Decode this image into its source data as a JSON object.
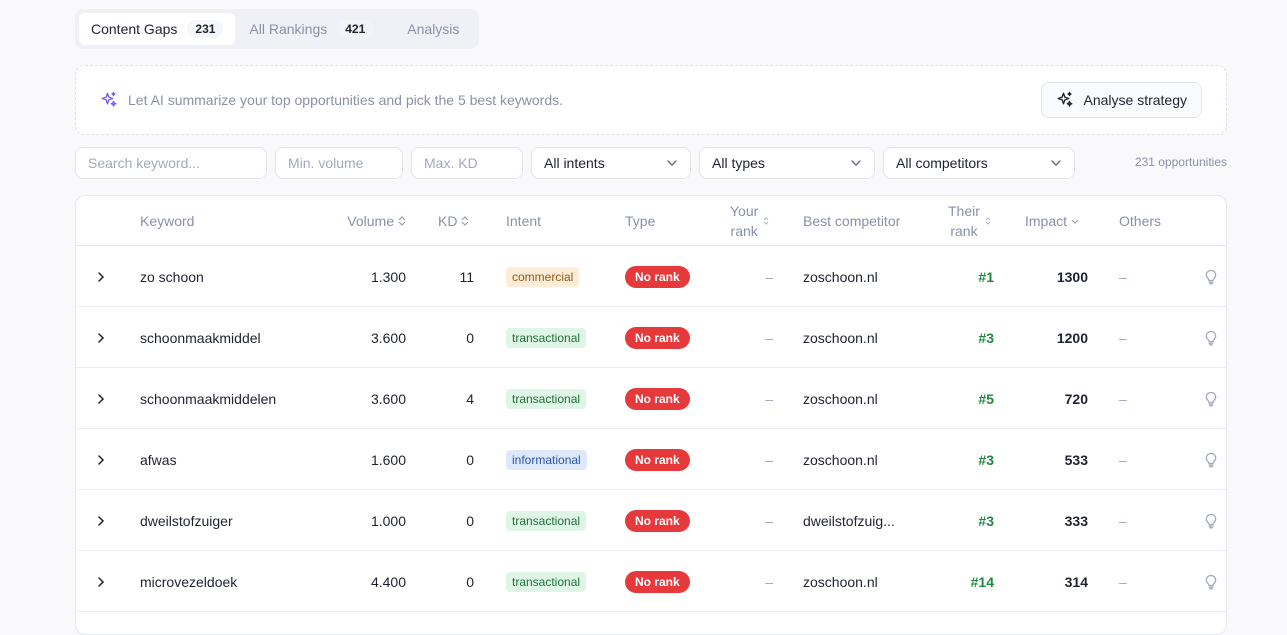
{
  "tabs": [
    {
      "label": "Content Gaps",
      "count": "231"
    },
    {
      "label": "All Rankings",
      "count": "421"
    },
    {
      "label": "Analysis"
    }
  ],
  "ai": {
    "text": "Let AI summarize your top opportunities and pick the 5 best keywords.",
    "button": "Analyse strategy"
  },
  "filters": {
    "search_placeholder": "Search keyword...",
    "min_volume_placeholder": "Min. volume",
    "max_kd_placeholder": "Max. KD",
    "intent": "All intents",
    "type": "All types",
    "competitor": "All competitors",
    "count_text": "231 opportunities"
  },
  "columns": {
    "keyword": "Keyword",
    "volume": "Volume",
    "kd": "KD",
    "intent": "Intent",
    "type": "Type",
    "your_rank_1": "Your",
    "your_rank_2": "rank",
    "best_competitor": "Best competitor",
    "their_rank_1": "Their",
    "their_rank_2": "rank",
    "impact": "Impact",
    "others": "Others"
  },
  "rows": [
    {
      "keyword": "zo schoon",
      "volume": "1.300",
      "kd": "11",
      "intent": "commercial",
      "type": "No rank",
      "your_rank": "–",
      "competitor": "zoschoon.nl",
      "their_rank": "#1",
      "impact": "1300",
      "others": "–"
    },
    {
      "keyword": "schoonmaakmiddel",
      "volume": "3.600",
      "kd": "0",
      "intent": "transactional",
      "type": "No rank",
      "your_rank": "–",
      "competitor": "zoschoon.nl",
      "their_rank": "#3",
      "impact": "1200",
      "others": "–"
    },
    {
      "keyword": "schoonmaakmiddelen",
      "volume": "3.600",
      "kd": "4",
      "intent": "transactional",
      "type": "No rank",
      "your_rank": "–",
      "competitor": "zoschoon.nl",
      "their_rank": "#5",
      "impact": "720",
      "others": "–"
    },
    {
      "keyword": "afwas",
      "volume": "1.600",
      "kd": "0",
      "intent": "informational",
      "type": "No rank",
      "your_rank": "–",
      "competitor": "zoschoon.nl",
      "their_rank": "#3",
      "impact": "533",
      "others": "–"
    },
    {
      "keyword": "dweilstofzuiger",
      "volume": "1.000",
      "kd": "0",
      "intent": "transactional",
      "type": "No rank",
      "your_rank": "–",
      "competitor": "dweilstofzuig...",
      "their_rank": "#3",
      "impact": "333",
      "others": "–"
    },
    {
      "keyword": "microvezeldoek",
      "volume": "4.400",
      "kd": "0",
      "intent": "transactional",
      "type": "No rank",
      "your_rank": "–",
      "competitor": "zoschoon.nl",
      "their_rank": "#14",
      "impact": "314",
      "others": "–"
    }
  ],
  "colors": {
    "accent_ai": "#7c5cf0",
    "no_rank": "#e5393b",
    "their_rank": "#1e8a3c"
  }
}
